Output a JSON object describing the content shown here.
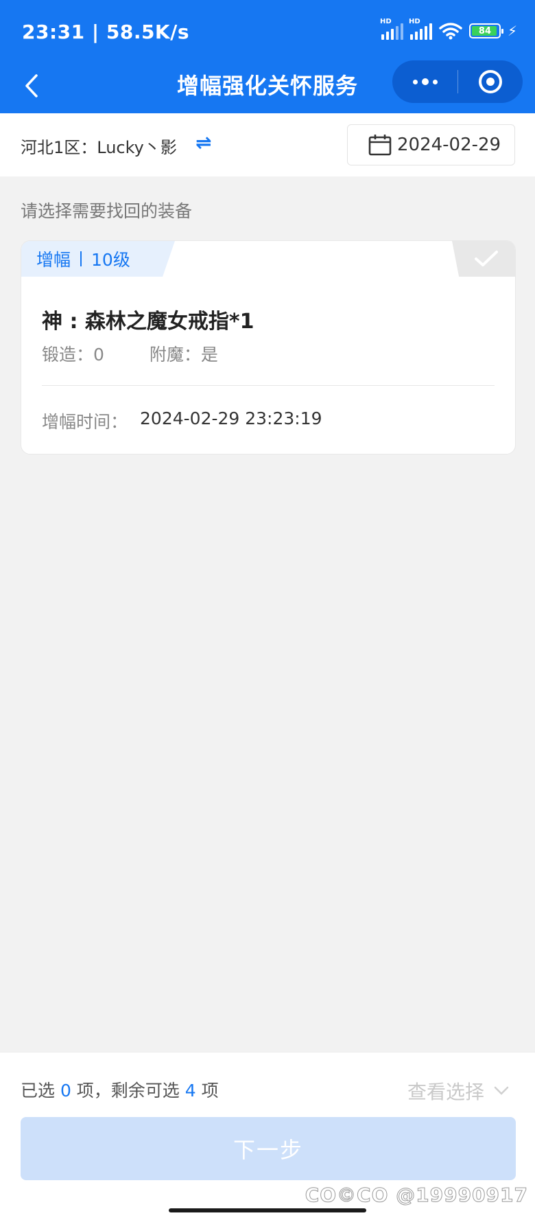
{
  "status_bar": {
    "time": "23:31 | 58.5K/s",
    "signal1_label": "HD",
    "signal2_label": "HD",
    "battery": "84"
  },
  "nav": {
    "title": "增幅强化关怀服务",
    "back_icon": "chevron-left-icon",
    "more_icon": "more-dots-icon",
    "close_icon": "target-circle-icon"
  },
  "account": {
    "label": "河北1区：Lucky丶影",
    "switch_icon": "⇌",
    "date": "2024-02-29"
  },
  "hint": "请选择需要找回的装备",
  "card": {
    "tag_type": "增幅",
    "tag_level": "10级",
    "name": "神 : 森林之魔女戒指*1",
    "forge_label": "锻造：0",
    "enchant_label": "附魔：是",
    "time_label": "增幅时间：",
    "time_value": "2024-02-29 23:23:19",
    "selected": false
  },
  "bottom": {
    "prefix": "已选 ",
    "selected_count": "0",
    "middle": " 项，剩余可选 ",
    "remaining_count": "4",
    "suffix": " 项",
    "view_selection": "查看选择",
    "next_button": "下一步"
  },
  "watermark": "CO©CO @19990917",
  "colors": {
    "primary": "#1677f2",
    "capsule": "#0c5ed1",
    "button_disabled": "#cde0fa",
    "background": "#f2f2f2"
  }
}
